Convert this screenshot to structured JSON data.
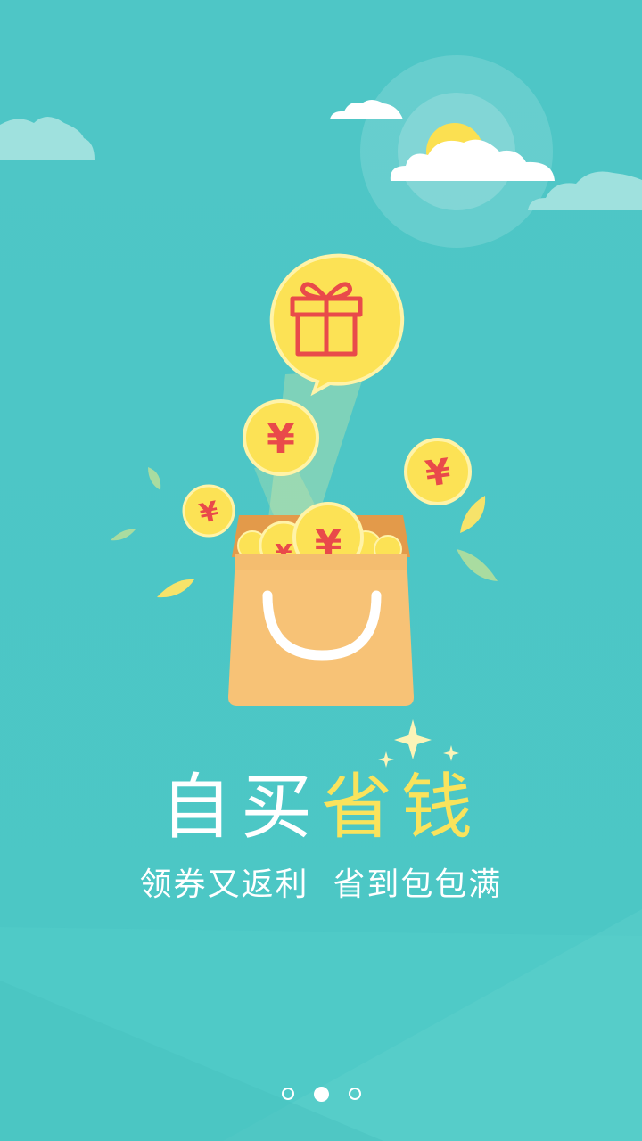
{
  "headline": {
    "part1": "自买",
    "part2": "省钱"
  },
  "subtitle": "领券又返利  省到包包满",
  "pager": {
    "total_pages": 3,
    "active_page": 2
  },
  "colors": {
    "background": "#4ec8c6",
    "accent_yellow": "#f9e35c",
    "coin": "#fce255",
    "coin_symbol": "#e94a4a",
    "bag": "#f7c276"
  },
  "icons": [
    "cloud-icon",
    "sun-icon",
    "gift-icon",
    "yen-coin-icon",
    "leaf-icon",
    "sparkle-icon",
    "shopping-bag-icon"
  ],
  "coin_symbol": "¥"
}
